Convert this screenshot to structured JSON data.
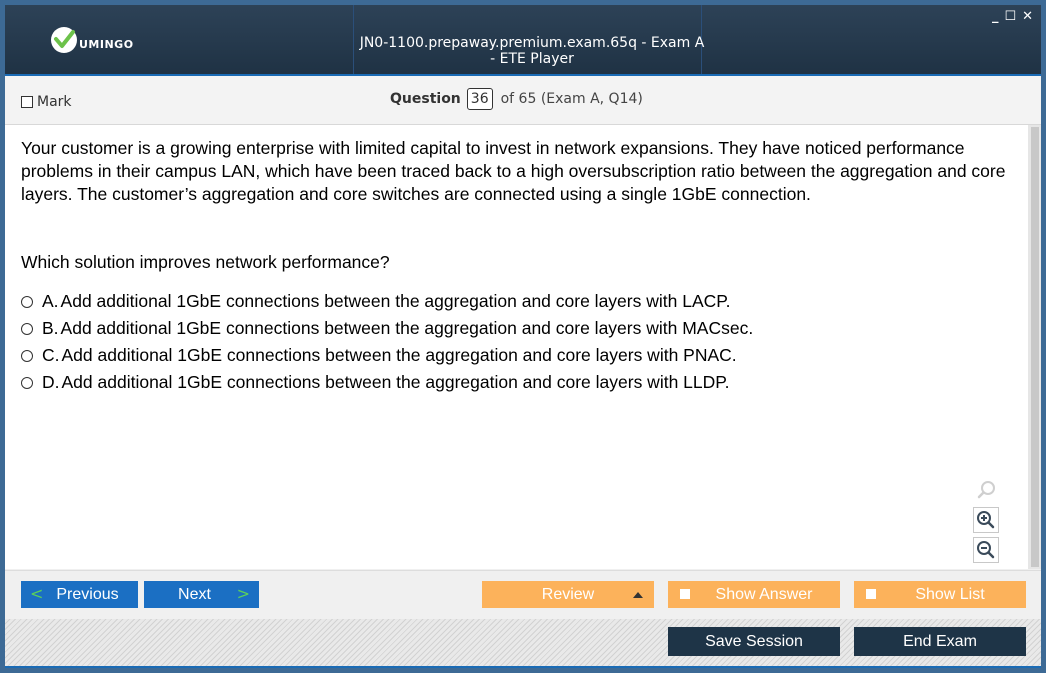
{
  "window": {
    "title": "JN0-1100.prepaway.premium.exam.65q - Exam A - ETE Player",
    "logo_text": "UMINGO",
    "controls": {
      "minimize": "_",
      "maximize": "☐",
      "close": "✕"
    }
  },
  "question_bar": {
    "mark_label": "Mark",
    "question_label": "Question",
    "question_number": "36",
    "of_text": "of 65 (Exam A, Q14)"
  },
  "question": {
    "stem": "Your customer is a growing enterprise with limited capital to invest in network expansions. They have noticed performance problems in their campus LAN, which have been traced back to a high oversubscription ratio between the aggregation and core layers. The customer’s aggregation and core switches are connected using a single 1GbE connection.",
    "prompt": "Which solution improves network performance?",
    "options": [
      {
        "letter": "A.",
        "text": "Add additional 1GbE connections between the aggregation and core layers with LACP."
      },
      {
        "letter": "B.",
        "text": "Add additional 1GbE connections between the aggregation and core layers with MACsec."
      },
      {
        "letter": "C.",
        "text": "Add additional 1GbE connections between the aggregation and core layers with PNAC."
      },
      {
        "letter": "D.",
        "text": "Add additional 1GbE connections between the aggregation and core layers with LLDP."
      }
    ]
  },
  "zoom": {
    "icons": [
      "search-icon",
      "zoom-in-icon",
      "zoom-out-icon"
    ]
  },
  "nav": {
    "previous": "Previous",
    "next": "Next",
    "review": "Review",
    "show_answer": "Show Answer",
    "show_list": "Show List",
    "save_session": "Save Session",
    "end_exam": "End Exam"
  },
  "colors": {
    "titlebar": "#1f3244",
    "accent_blue": "#1b6fc3",
    "orange": "#fcb25b",
    "dark_button": "#1e3447"
  }
}
